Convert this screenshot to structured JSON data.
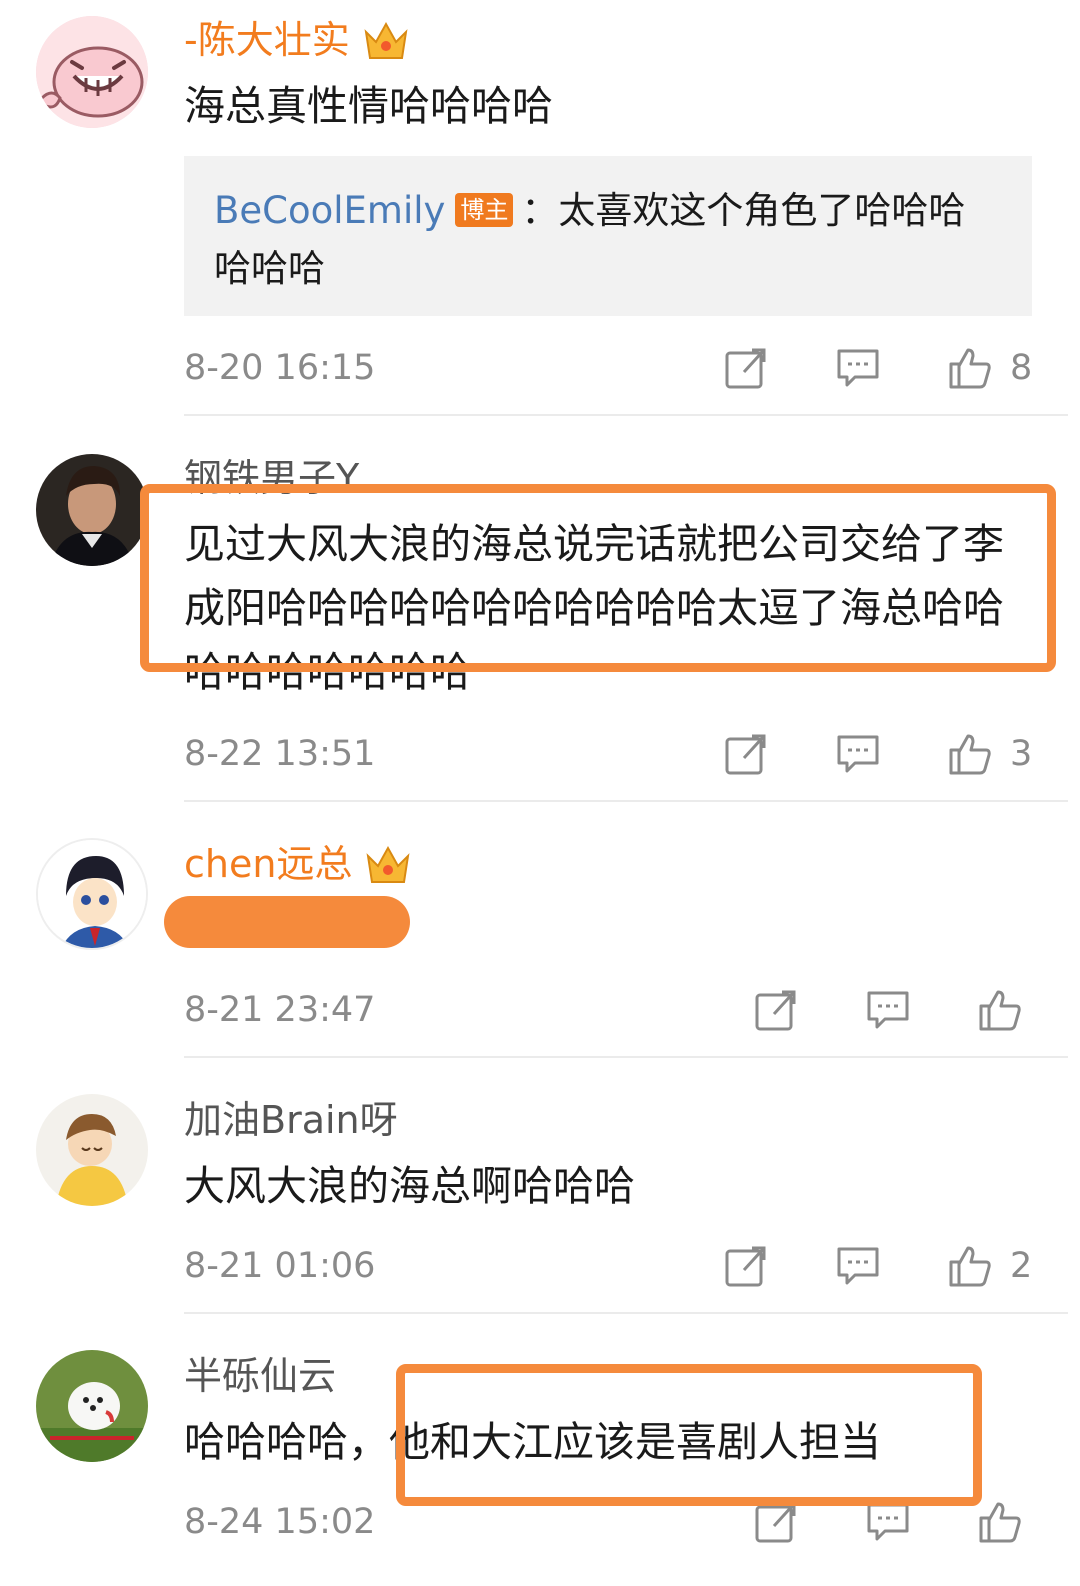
{
  "comments": [
    {
      "username": "-陈大壮实",
      "text": "海总真性情哈哈哈哈",
      "reply": {
        "user": "BeCoolEmily",
        "badge": "博主",
        "sep": "：",
        "text": "太喜欢这个角色了哈哈哈哈哈哈"
      },
      "time": "8-20 16:15",
      "likes": "8"
    },
    {
      "username": "钢铁男子Y",
      "text": "见过大风大浪的海总说完话就把公司交给了李成阳哈哈哈哈哈哈哈哈哈哈哈太逗了海总哈哈哈哈哈哈哈哈哈",
      "time": "8-22 13:51",
      "likes": "3"
    },
    {
      "username": "chen远总",
      "text": "",
      "time": "8-21 23:47",
      "likes": ""
    },
    {
      "username": "加油Brain呀",
      "text": "大风大浪的海总啊哈哈哈",
      "time": "8-21 01:06",
      "likes": "2"
    },
    {
      "username": "半砾仙云",
      "text": "哈哈哈哈，他和大江应该是喜剧人担当",
      "time": "8-24 15:02",
      "likes": ""
    }
  ],
  "icons": {
    "share": "share-icon",
    "comment": "comment-icon",
    "like": "thumbs-up-icon",
    "vip": "crown-icon"
  },
  "colors": {
    "vip_name": "#f27c1e",
    "reply_user": "#4a7bb7",
    "badge": "#f07a1f",
    "highlight": "#f58a3c",
    "meta": "#8a8a8a"
  }
}
